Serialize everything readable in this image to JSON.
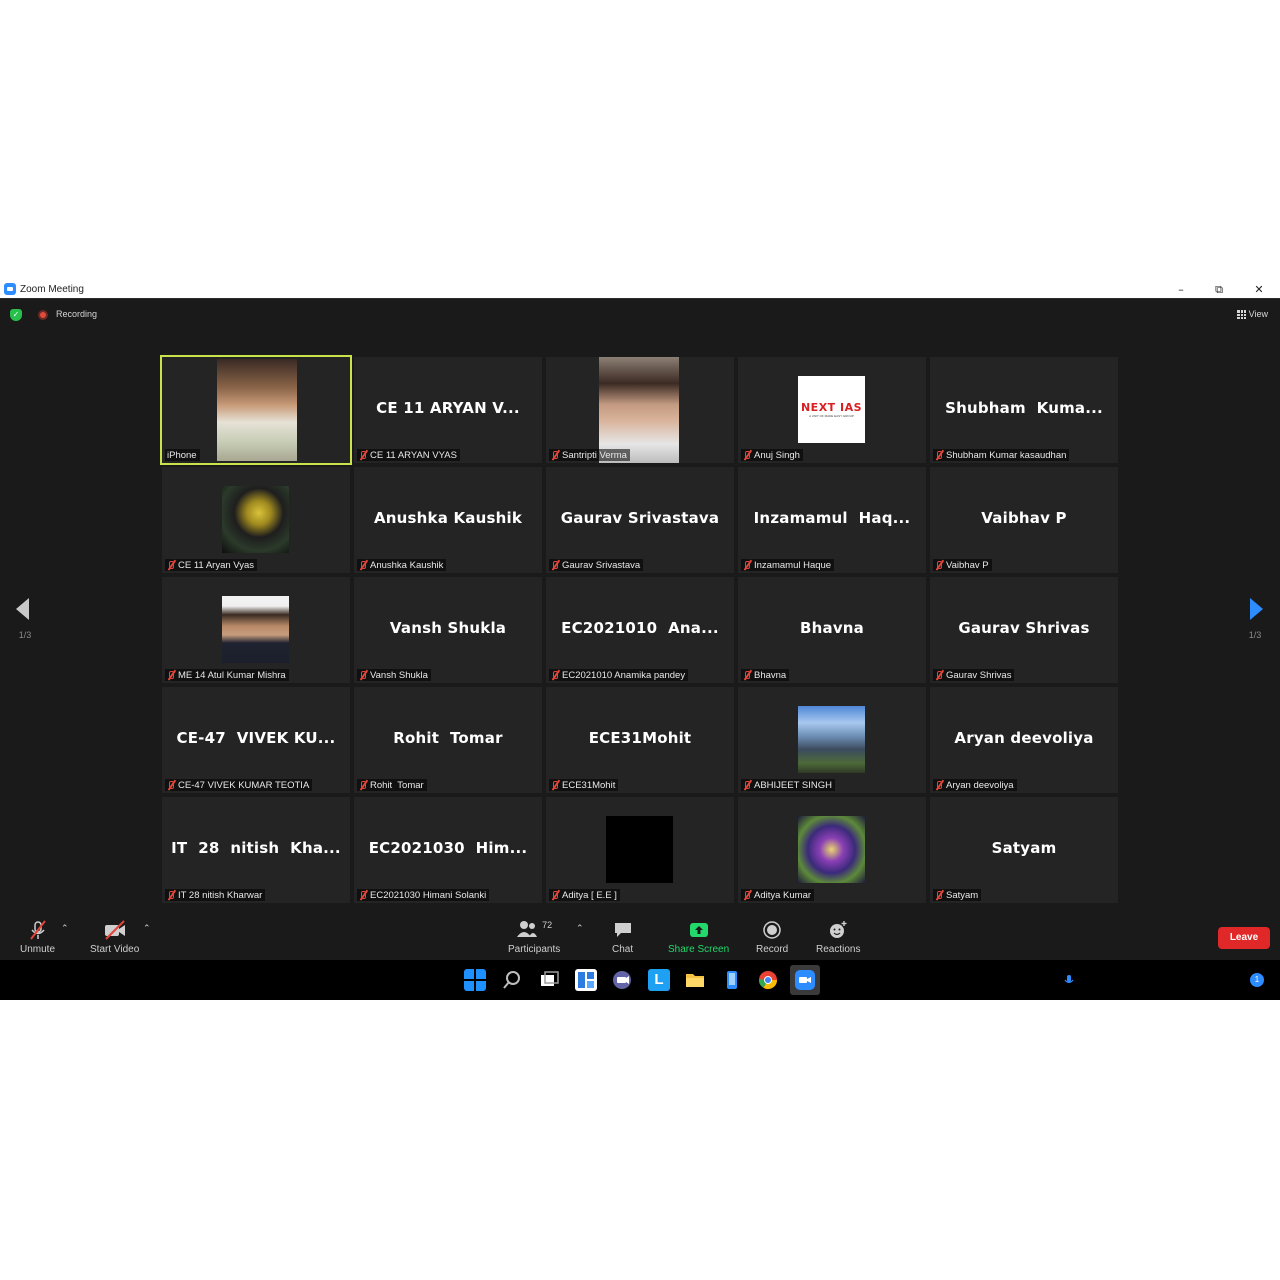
{
  "window": {
    "title": "Zoom Meeting"
  },
  "topbar": {
    "recording_label": "Recording",
    "view_label": "View"
  },
  "tiles": [
    {
      "big": "",
      "name": "iPhone"
    },
    {
      "big": "CE 11 ARYAN V...",
      "name": "CE 11 ARYAN VYAS"
    },
    {
      "big": "",
      "name": "Santripti Verma"
    },
    {
      "big": "",
      "name": "Anuj Singh"
    },
    {
      "big": "Shubham  Kuma...",
      "name": "Shubham Kumar kasaudhan"
    },
    {
      "big": "",
      "name": "CE 11 Aryan Vyas"
    },
    {
      "big": "Anushka Kaushik",
      "name": "Anushka Kaushik"
    },
    {
      "big": "Gaurav Srivastava",
      "name": "Gaurav Srivastava"
    },
    {
      "big": "Inzamamul  Haq...",
      "name": "Inzamamul Haque"
    },
    {
      "big": "Vaibhav P",
      "name": "Vaibhav P"
    },
    {
      "big": "",
      "name": "ME 14 Atul Kumar Mishra"
    },
    {
      "big": "Vansh Shukla",
      "name": "Vansh Shukla"
    },
    {
      "big": "EC2021010  Ana...",
      "name": "EC2021010 Anamika pandey"
    },
    {
      "big": "Bhavna",
      "name": "Bhavna"
    },
    {
      "big": "Gaurav Shrivas",
      "name": "Gaurav Shrivas"
    },
    {
      "big": "CE-47  VIVEK KU...",
      "name": "CE-47 VIVEK KUMAR TEOTIA"
    },
    {
      "big": "Rohit  Tomar",
      "name": "Rohit  Tomar"
    },
    {
      "big": "ECE31Mohit",
      "name": "ECE31Mohit"
    },
    {
      "big": "",
      "name": "ABHIJEET SINGH"
    },
    {
      "big": "Aryan deevoliya",
      "name": "Aryan deevoliya"
    },
    {
      "big": "IT  28  nitish  Kha...",
      "name": "IT 28 nitish Kharwar"
    },
    {
      "big": "EC2021030  Him...",
      "name": "EC2021030 Himani Solanki"
    },
    {
      "big": "",
      "name": "Aditya [ E.E ]"
    },
    {
      "big": "",
      "name": "Aditya Kumar"
    },
    {
      "big": "Satyam",
      "name": "Satyam"
    }
  ],
  "logo_text": "NEXT IAS",
  "logo_subtext": "A UNIT OF MADE EASY GROUP",
  "pager": {
    "left": "1/3",
    "right": "1/3"
  },
  "toolbar": {
    "unmute": "Unmute",
    "start_video": "Start Video",
    "participants": "Participants",
    "participants_count": "72",
    "chat": "Chat",
    "share_screen": "Share Screen",
    "record": "Record",
    "reactions": "Reactions",
    "leave": "Leave"
  },
  "taskbar": {
    "notification_count": "1"
  },
  "colors": {
    "share_green": "#23d96c",
    "leave_red": "#e02828",
    "active_speaker": "#c9e34b"
  }
}
